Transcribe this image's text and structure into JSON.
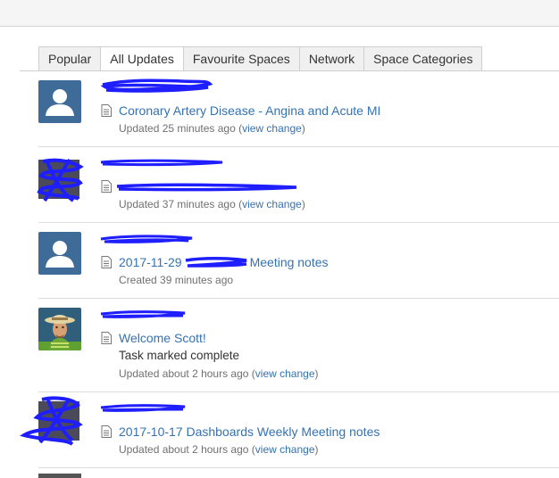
{
  "tabs": [
    {
      "label": "Popular",
      "active": false
    },
    {
      "label": "All Updates",
      "active": true
    },
    {
      "label": "Favourite Spaces",
      "active": false
    },
    {
      "label": "Network",
      "active": false
    },
    {
      "label": "Space Categories",
      "active": false
    }
  ],
  "feed": [
    {
      "avatar": "default-user-icon",
      "title": "Coronary Artery Disease - Angina and Acute MI",
      "meta_prefix": "Updated 25 minutes ago (",
      "meta_link": "view change",
      "meta_suffix": ")"
    },
    {
      "avatar": "redacted-avatar",
      "title": "",
      "meta_prefix": "Updated 37 minutes ago (",
      "meta_link": "view change",
      "meta_suffix": ")"
    },
    {
      "avatar": "default-user-icon",
      "title_start": "2017-11-29",
      "title_end": "Meeting notes",
      "meta_prefix": "Created 39 minutes ago",
      "meta_link": "",
      "meta_suffix": ""
    },
    {
      "avatar": "hat-man-avatar",
      "title": "Welcome Scott!",
      "extra": "Task marked complete",
      "meta_prefix": "Updated about 2 hours ago (",
      "meta_link": "view change",
      "meta_suffix": ")"
    },
    {
      "avatar": "redacted-avatar",
      "title": "2017-10-17 Dashboards Weekly Meeting notes",
      "meta_prefix": "Updated about 2 hours ago (",
      "meta_link": "view change",
      "meta_suffix": ")"
    }
  ],
  "colors": {
    "link": "#3572b0",
    "redaction": "#1e1eff",
    "avatar_blue": "#3f6b98"
  }
}
